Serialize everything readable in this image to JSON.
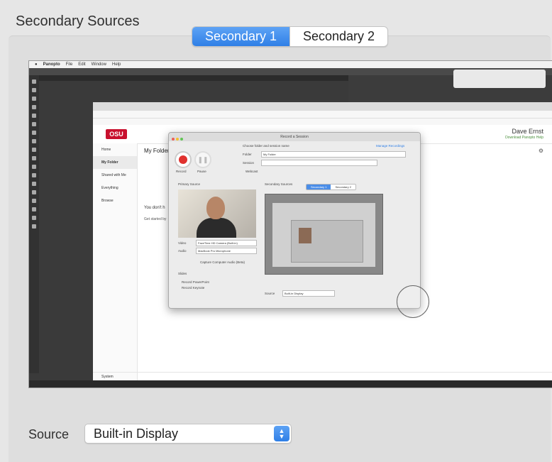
{
  "header": {
    "title": "Secondary Sources"
  },
  "tabs": [
    {
      "label": "Secondary 1",
      "selected": true
    },
    {
      "label": "Secondary 2",
      "selected": false
    }
  ],
  "preview": {
    "menubar": {
      "app": "Panopto",
      "items": [
        "File",
        "Edit",
        "Window",
        "Help"
      ]
    },
    "browser": {
      "user_name": "Dave Ernst",
      "user_sub": "Download Panopto   Help",
      "logo": "OSU",
      "nav": [
        "Home",
        "My Folder",
        "Shared with Me",
        "Everything",
        "Browse"
      ],
      "folder_title": "My Folder",
      "content_text": "You don't h",
      "content_text2": "Get started by",
      "footer_item": "System"
    },
    "dialog": {
      "title": "Record a Session",
      "record_label": "Record",
      "pause_label": "Pause",
      "choose_label": "Choose folder and session name",
      "manage_recordings": "Manage Recordings",
      "folder_label": "Folder",
      "folder_value": "My Folder",
      "session_label": "Session",
      "webcast_label": "Webcast",
      "primary_source_label": "Primary Source",
      "secondary_sources_label": "Secondary Sources",
      "video_label": "Video",
      "audio_label": "Audio",
      "video_value": "FaceTime HD Camera (Built-in)",
      "audio_value": "MacBook Pro Microphone",
      "capture_audio": "Capture Computer Audio (Beta)",
      "slides_label": "Slides",
      "record_powerpoint": "Record PowerPoint",
      "record_keynote": "Record Keynote",
      "sec_tab1": "Secondary 1",
      "sec_tab2": "Secondary 2",
      "source_label": "Source",
      "source_value": "Built-in Display"
    }
  },
  "source": {
    "label": "Source",
    "value": "Built-in Display",
    "arrows_icon": "up-down-chevron-icon"
  },
  "colors": {
    "accent": "#2f7fe6",
    "record": "#e0312e",
    "osu": "#c8102e"
  }
}
